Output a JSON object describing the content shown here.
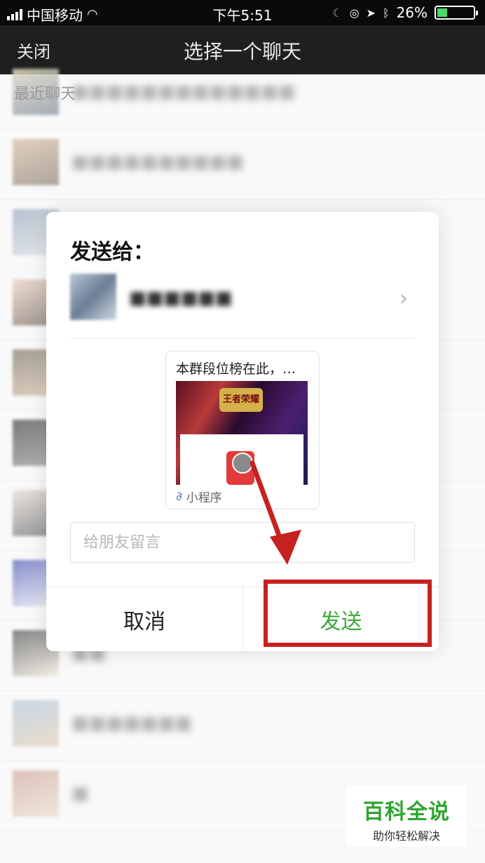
{
  "status_bar": {
    "carrier": "中国移动",
    "time": "下午5:51",
    "battery_text": "26%",
    "battery_level": 0.26,
    "icons": [
      "signal-icon",
      "wifi-icon",
      "moon-icon",
      "lock-rotation-icon",
      "location-icon",
      "bluetooth-icon",
      "battery-icon"
    ]
  },
  "nav": {
    "close_label": "关闭",
    "title": "选择一个聊天"
  },
  "list": {
    "section_label": "最近聊天",
    "rows": [
      {
        "name": "■■■■■■■■■■■■■"
      },
      {
        "name": "■■■■■■■■■■"
      },
      {
        "name": ""
      },
      {
        "name": ""
      },
      {
        "name": ""
      },
      {
        "name": ""
      },
      {
        "name": ""
      },
      {
        "name": ""
      },
      {
        "name": "■■"
      },
      {
        "name": "■■■■■■■"
      },
      {
        "name": "■"
      }
    ]
  },
  "dialog": {
    "title": "发送给：",
    "recipient_name": "■■■■■■",
    "card_title": "本群段位榜在此，…",
    "card_footer": "小程序",
    "card_logo_text": "王者荣耀",
    "message_placeholder": "给朋友留言",
    "cancel_label": "取消",
    "send_label": "发送"
  },
  "colors": {
    "send_green": "#3aa83a",
    "highlight_red": "#c62121"
  },
  "watermark": {
    "title": "百科全说",
    "subtitle": "助你轻松解决"
  }
}
